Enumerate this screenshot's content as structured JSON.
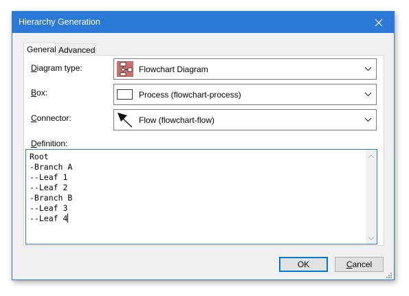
{
  "window": {
    "title": "Hierarchy Generation"
  },
  "tabs": [
    {
      "label": "General",
      "active": true
    },
    {
      "label": "Advanced",
      "active": false
    }
  ],
  "fields": {
    "diagram_type": {
      "label_mnemonic": "D",
      "label_rest": "iagram type:",
      "value": "Flowchart Diagram",
      "icon": "flowchart-diagram-icon"
    },
    "box": {
      "label_mnemonic": "B",
      "label_rest": "ox:",
      "value": "Process (flowchart-process)",
      "icon": "process-shape-icon"
    },
    "connector": {
      "label_mnemonic": "C",
      "label_rest": "onnector:",
      "value": "Flow (flowchart-flow)",
      "icon": "flow-arrow-icon"
    },
    "definition": {
      "label_mnemonic": "D",
      "label_rest": "efinition:",
      "value": "Root\n-Branch A\n--Leaf 1\n--Leaf 2\n-Branch B\n--Leaf 3\n--Leaf 4"
    }
  },
  "buttons": {
    "ok": "OK",
    "cancel_mnemonic": "C",
    "cancel_rest": "ancel"
  },
  "colors": {
    "titlebar": "#2b79d6",
    "dialog_bg": "#f0f0f0",
    "focus_border": "#0078d7"
  }
}
